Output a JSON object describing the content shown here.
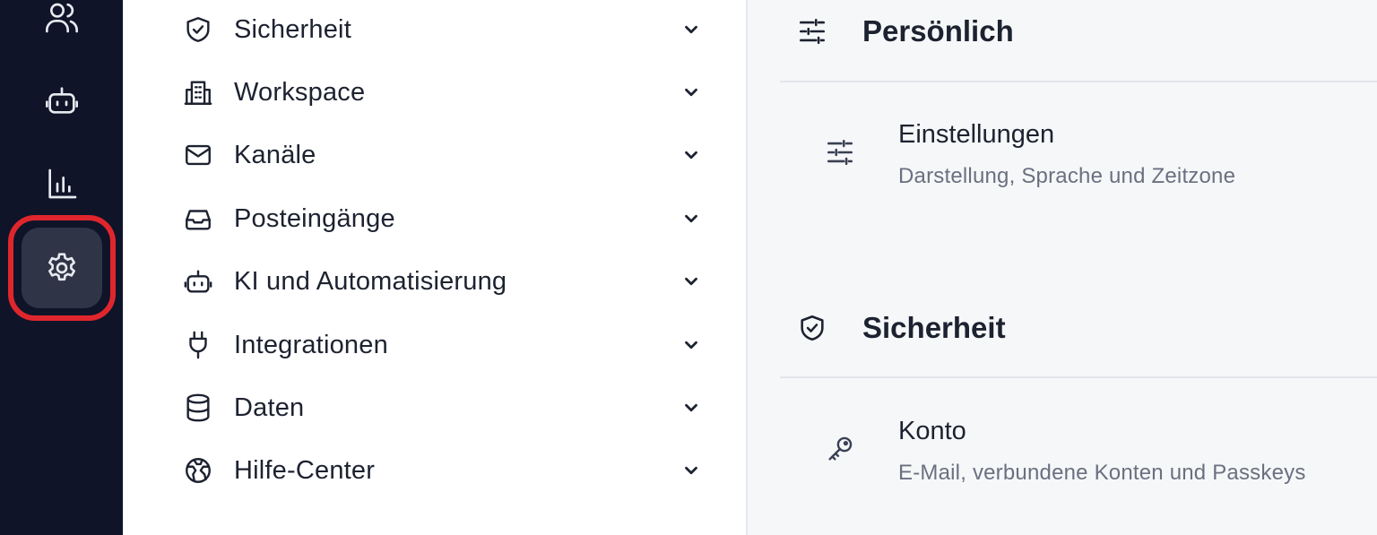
{
  "rail": {
    "items": [
      {
        "icon": "users-icon",
        "active": false
      },
      {
        "icon": "robot-icon",
        "active": false
      },
      {
        "icon": "bar-chart-icon",
        "active": false
      },
      {
        "icon": "gear-icon",
        "active": true
      }
    ],
    "highlight_color": "#e0262d"
  },
  "nav": {
    "items": [
      {
        "label": "Sicherheit",
        "icon": "shield-check-icon"
      },
      {
        "label": "Workspace",
        "icon": "building-icon"
      },
      {
        "label": "Kanäle",
        "icon": "mail-icon"
      },
      {
        "label": "Posteingänge",
        "icon": "inbox-icon"
      },
      {
        "label": "KI und Automatisierung",
        "icon": "robot-icon"
      },
      {
        "label": "Integrationen",
        "icon": "plug-icon"
      },
      {
        "label": "Daten",
        "icon": "database-icon"
      },
      {
        "label": "Hilfe-Center",
        "icon": "globe-icon"
      }
    ]
  },
  "content": {
    "sections": [
      {
        "title": "Persönlich",
        "icon": "sliders-icon",
        "cards": [
          {
            "title": "Einstellungen",
            "description": "Darstellung, Sprache und Zeitzone",
            "icon": "sliders-icon"
          }
        ]
      },
      {
        "title": "Sicherheit",
        "icon": "shield-check-icon",
        "cards": [
          {
            "title": "Konto",
            "description": "E-Mail, verbundene Konten und Passkeys",
            "icon": "key-icon"
          }
        ]
      }
    ]
  },
  "colors": {
    "rail_bg": "#0f1428",
    "active_bg": "#2f3446",
    "panel_bg": "#ffffff",
    "content_bg": "#f6f7f9",
    "text": "#1d2230",
    "muted": "#6b7080"
  }
}
